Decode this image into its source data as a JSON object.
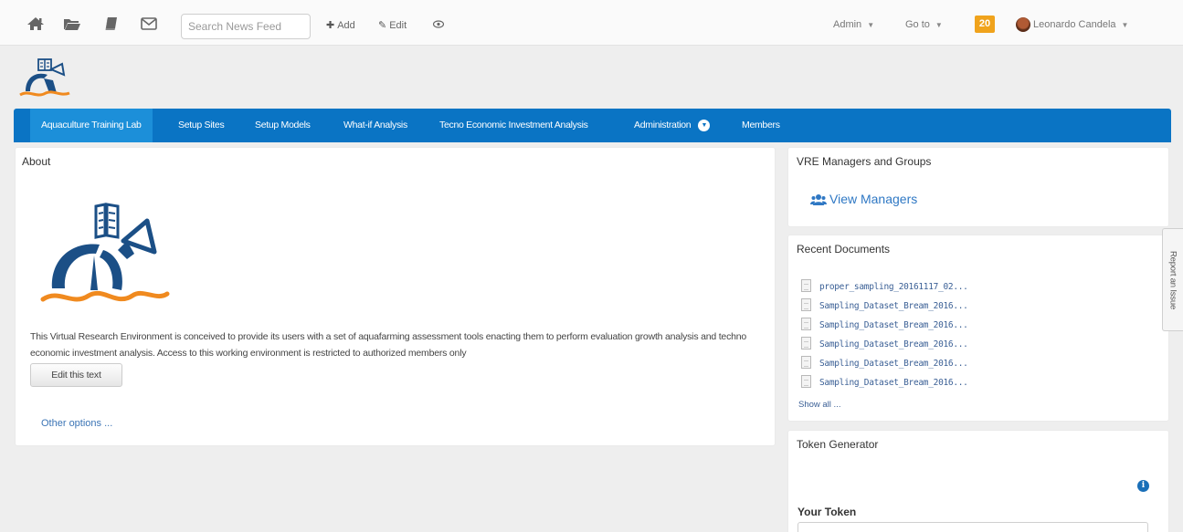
{
  "colors": {
    "nav_bg": "#0a74c4",
    "nav_active": "#1c8fd9",
    "badge": "#f0a31c",
    "link": "#2f78c4",
    "logo_blue": "#1b4f86",
    "logo_orange": "#f08a1f"
  },
  "topbar": {
    "icons": [
      "home-icon",
      "folder-icon",
      "book-icon",
      "envelope-icon"
    ],
    "search": {
      "placeholder": "Search News Feed",
      "value": ""
    },
    "add_label": "Add",
    "edit_label": "Edit",
    "admin_label": "Admin",
    "goto_label": "Go to",
    "notification_count": "20",
    "user_name": "Leonardo Candela"
  },
  "nav": {
    "items": [
      {
        "label": "Aquaculture Training Lab",
        "active": true
      },
      {
        "label": "Setup Sites"
      },
      {
        "label": "Setup Models"
      },
      {
        "label": "What-if Analysis"
      },
      {
        "label": "Tecno Economic Investment Analysis"
      },
      {
        "label": "Administration",
        "dropdown": true
      },
      {
        "label": "Members"
      }
    ]
  },
  "about": {
    "title": "About",
    "text": "This Virtual Research Environment is conceived to provide its users with a set of aquafarming assessment tools enacting them to perform evaluation growth analysis and techno economic investment analysis. Access to this working environment is restricted to authorized members only",
    "edit_button": "Edit this text",
    "other_options": "Other options ..."
  },
  "vre_managers": {
    "title": "VRE Managers and Groups",
    "view_managers": "View Managers"
  },
  "recent_documents": {
    "title": "Recent Documents",
    "items": [
      "proper_sampling_20161117_02...",
      "Sampling_Dataset_Bream_2016...",
      "Sampling_Dataset_Bream_2016...",
      "Sampling_Dataset_Bream_2016...",
      "Sampling_Dataset_Bream_2016...",
      "Sampling_Dataset_Bream_2016..."
    ],
    "show_all": "Show all ..."
  },
  "token_generator": {
    "title": "Token Generator",
    "your_token": "Your Token",
    "token_value": ""
  },
  "report_issue": "Report an Issue"
}
